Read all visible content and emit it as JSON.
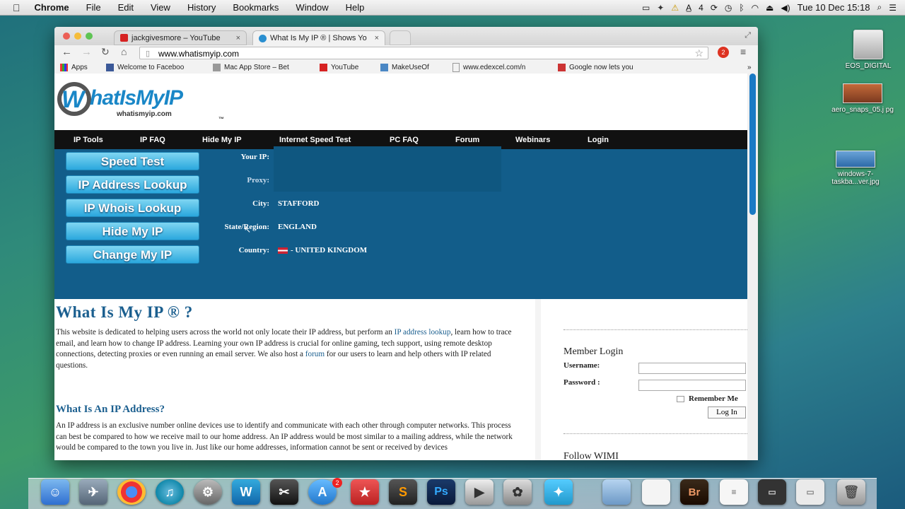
{
  "menubar": {
    "apple": "",
    "app": "Chrome",
    "items": [
      "File",
      "Edit",
      "View",
      "History",
      "Bookmarks",
      "Window",
      "Help"
    ],
    "status_number": "4",
    "datetime": "Tue 10 Dec  15:18"
  },
  "desktop": {
    "icons": [
      {
        "label": "EOS_DIGITAL"
      },
      {
        "label": "aero_snaps_05.j pg"
      },
      {
        "label": "windows-7-taskba...ver.jpg"
      }
    ]
  },
  "browser": {
    "tabs": [
      {
        "title": "jackgivesmore – YouTube",
        "close": "×"
      },
      {
        "title": "What Is My IP ® | Shows Yo",
        "close": "×"
      }
    ],
    "url": "www.whatismyip.com",
    "extension_badge": "2",
    "bookmarks": [
      {
        "label": "Apps"
      },
      {
        "label": "Welcome to Faceboo"
      },
      {
        "label": "Mac App Store – Bet"
      },
      {
        "label": "YouTube"
      },
      {
        "label": "MakeUseOf"
      },
      {
        "label": "www.edexcel.com/n"
      },
      {
        "label": "Google now lets you"
      }
    ],
    "overflow": "»"
  },
  "site": {
    "logo_text": "hatIsMyIP",
    "logo_letter": "W",
    "logo_sub": "whatismyip.com",
    "logo_tm": "™",
    "nav": [
      "IP Tools",
      "IP FAQ",
      "Hide My IP",
      "Internet Speed Test",
      "PC FAQ",
      "Forum",
      "Webinars",
      "Login"
    ],
    "buttons": [
      "Speed Test",
      "IP Address Lookup",
      "IP Whois Lookup",
      "Hide My IP",
      "Change My IP"
    ],
    "info": {
      "your_ip_label": "Your IP:",
      "proxy_label": "Proxy:",
      "city_label": "City:",
      "city": "STAFFORD",
      "region_label": "State/Region:",
      "region": "ENGLAND",
      "country_label": "Country:",
      "country": "- UNITED KINGDOM"
    },
    "title": "What Is My IP ® ?",
    "intro_1": "This website is dedicated to helping users across the world not only locate their IP address, but perform an ",
    "intro_link1": "IP address lookup",
    "intro_2": ", learn how to trace email, and learn how to change IP address. Learning your own IP address is crucial for online gaming, tech support, using remote desktop connections, detecting proxies or even running an email server. We also host a ",
    "intro_link2": "forum",
    "intro_3": " for our users to learn and help others with IP related questions.",
    "subtitle": "What Is An IP Address?",
    "para2": "An IP address is an exclusive number online devices use to identify and communicate with each other through computer networks. This process can best be compared to how we receive mail to our home address. An IP address would be most similar to a mailing address, while the network would be compared to the town you live in. Just like our home addresses, information cannot be sent or received by devices",
    "sidebar": {
      "member_login": "Member Login",
      "username": "Username:",
      "password": "Password :",
      "remember": "Remember Me",
      "login_button": "Log In",
      "follow": "Follow WIMI"
    }
  },
  "dock": {
    "badge_appstore": "2"
  }
}
